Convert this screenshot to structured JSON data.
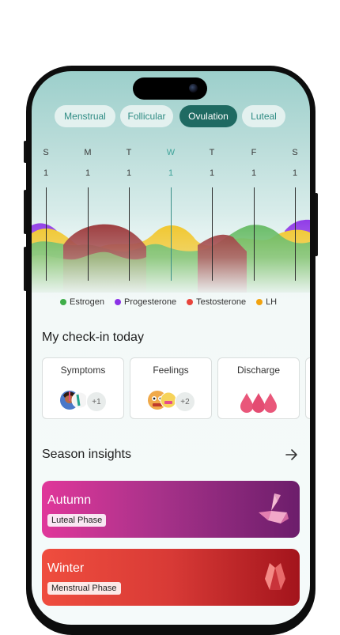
{
  "phase_tabs": [
    {
      "label": "Menstrual",
      "active": false
    },
    {
      "label": "Follicular",
      "active": false
    },
    {
      "label": "Ovulation",
      "active": true
    },
    {
      "label": "Luteal",
      "active": false
    }
  ],
  "week": [
    {
      "day": "S",
      "date": "1",
      "today": false
    },
    {
      "day": "M",
      "date": "1",
      "today": false
    },
    {
      "day": "T",
      "date": "1",
      "today": false
    },
    {
      "day": "W",
      "date": "1",
      "today": true
    },
    {
      "day": "T",
      "date": "1",
      "today": false
    },
    {
      "day": "F",
      "date": "1",
      "today": false
    },
    {
      "day": "S",
      "date": "1",
      "today": false
    }
  ],
  "legend": [
    {
      "label": "Estrogen",
      "color": "#3fae49"
    },
    {
      "label": "Progesterone",
      "color": "#8b32e6"
    },
    {
      "label": "Testosterone",
      "color": "#e8453c"
    },
    {
      "label": "LH",
      "color": "#f2a30f"
    }
  ],
  "checkin": {
    "title": "My check-in today",
    "cards": [
      {
        "label": "Symptoms",
        "extra": "+1"
      },
      {
        "label": "Feelings",
        "extra": "+2"
      },
      {
        "label": "Discharge"
      }
    ]
  },
  "insights": {
    "title": "Season insights",
    "arrow_icon": "arrow-right-icon",
    "seasons": [
      {
        "name": "Autumn",
        "phase": "Luteal Phase",
        "icon": "origami-swan-icon"
      },
      {
        "name": "Winter",
        "phase": "Menstrual Phase",
        "icon": "origami-leaf-icon"
      }
    ]
  }
}
